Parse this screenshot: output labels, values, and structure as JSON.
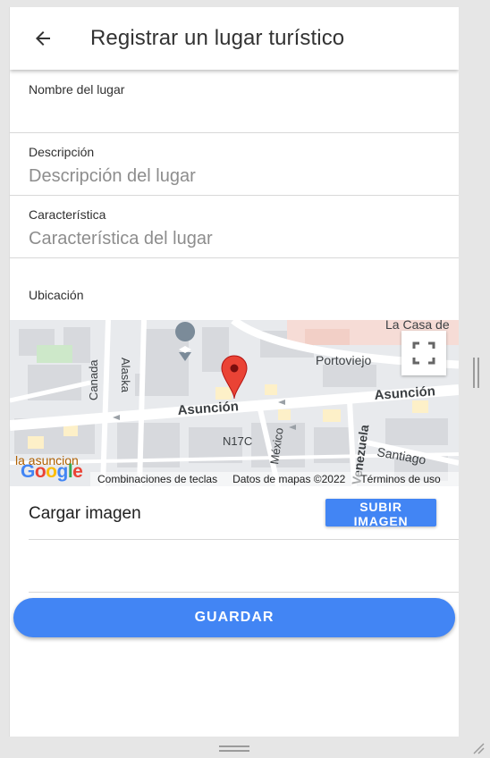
{
  "header": {
    "title": "Registrar un lugar turístico",
    "back_icon": "arrow-left-icon"
  },
  "form": {
    "name": {
      "label": "Nombre del lugar",
      "value": "",
      "placeholder": ""
    },
    "description": {
      "label": "Descripción",
      "value": "",
      "placeholder": "Descripción del lugar"
    },
    "feature": {
      "label": "Característica",
      "value": "",
      "placeholder": "Característica del lugar"
    },
    "location_label": "Ubicación"
  },
  "map": {
    "labels": {
      "casa": "La Casa de",
      "portoviejo": "Portoviejo",
      "asuncion_main": "Asunción",
      "asuncion_right": "Asunción",
      "canada": "Canada",
      "alaska": "Alaska",
      "n17c": "N17C",
      "mexico": "México",
      "venezuela": "Venezuela",
      "santiago": "Santiago",
      "la_asuncion": "la asuncion"
    },
    "logo": "Google",
    "footer": {
      "shortcuts": "Combinaciones de teclas",
      "data": "Datos de mapas ©2022",
      "terms": "Términos de uso"
    },
    "fullscreen_icon": "fullscreen-icon",
    "marker_icon": "map-pin-icon"
  },
  "image": {
    "label": "Cargar imagen",
    "upload_button": "SUBIR IMAGEN"
  },
  "save_button": "GUARDAR",
  "colors": {
    "accent": "#4285f4",
    "marker": "#ea4335"
  }
}
